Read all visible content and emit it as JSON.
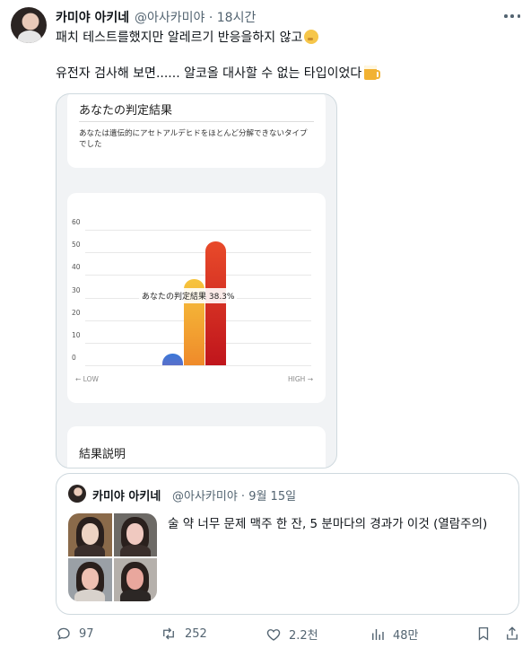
{
  "tweet": {
    "author_name": "카미야 아키네",
    "author_handle": "@아사카미야 · 18시간",
    "text_line1": "패치 테스트를했지만 알레르기 반응을하지 않고",
    "text_line2": "유전자 검사해 보면...... 알코올 대사할 수 없는 타입이었다",
    "emoji1": "thinking-face-icon",
    "emoji2": "beer-mug-icon"
  },
  "media": {
    "card1_title": "あなたの判定結果",
    "card1_desc": "あなたは遺伝的にアセトアルデヒドをほとんど分解できないタイプでした",
    "card3_title": "結果説明",
    "axis_low": "← LOW",
    "axis_high": "HIGH →",
    "tooltip": "あなたの判定結果 38.3%"
  },
  "chart_data": {
    "type": "bar",
    "categories": [
      "LOW",
      "",
      "HIGH"
    ],
    "values": [
      5,
      38.3,
      55
    ],
    "yticks": [
      "0",
      "10",
      "20",
      "30",
      "40",
      "50",
      "60"
    ],
    "ylim": [
      0,
      60
    ],
    "colors": [
      "#3a78d8",
      "#f2a531",
      "#d42a20"
    ],
    "annotation": "あなたの判定結果 38.3%"
  },
  "quote": {
    "author_name": "카미야 아키네",
    "author_handle": "@아사카미야 · 9월 15일",
    "text": "술 약 너무 문제 맥주 한 잔, 5 분마다의 경과가 이것 (열람주의)"
  },
  "actions": {
    "replies": "97",
    "retweets": "252",
    "likes": "2.2천",
    "views": "48만"
  }
}
